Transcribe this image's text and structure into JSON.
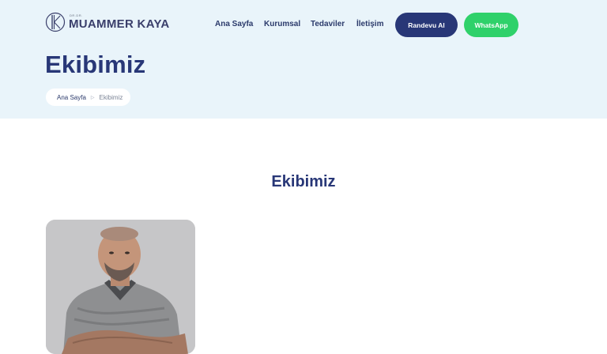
{
  "brand": {
    "logo_small": "DR.DR.",
    "name": "MUAMMER KAYA",
    "colors": {
      "primary": "#283777",
      "whatsapp": "#2fd16a",
      "hero_bg": "#e9f4fa"
    }
  },
  "nav": {
    "items": [
      {
        "label": "Ana Sayfa"
      },
      {
        "label": "Kurumsal"
      },
      {
        "label": "Tedaviler"
      },
      {
        "label": "İletişim"
      }
    ],
    "appointment_button": "Randevu Al",
    "whatsapp_button": "WhatsApp"
  },
  "hero": {
    "title": "Ekibimiz",
    "breadcrumb": {
      "home": "Ana Sayfa",
      "separator_icon": "triangle-right-icon",
      "current": "Ekibimiz"
    }
  },
  "team": {
    "section_title": "Ekibimiz",
    "members": [
      {
        "photo": "doctor-portrait"
      }
    ]
  }
}
